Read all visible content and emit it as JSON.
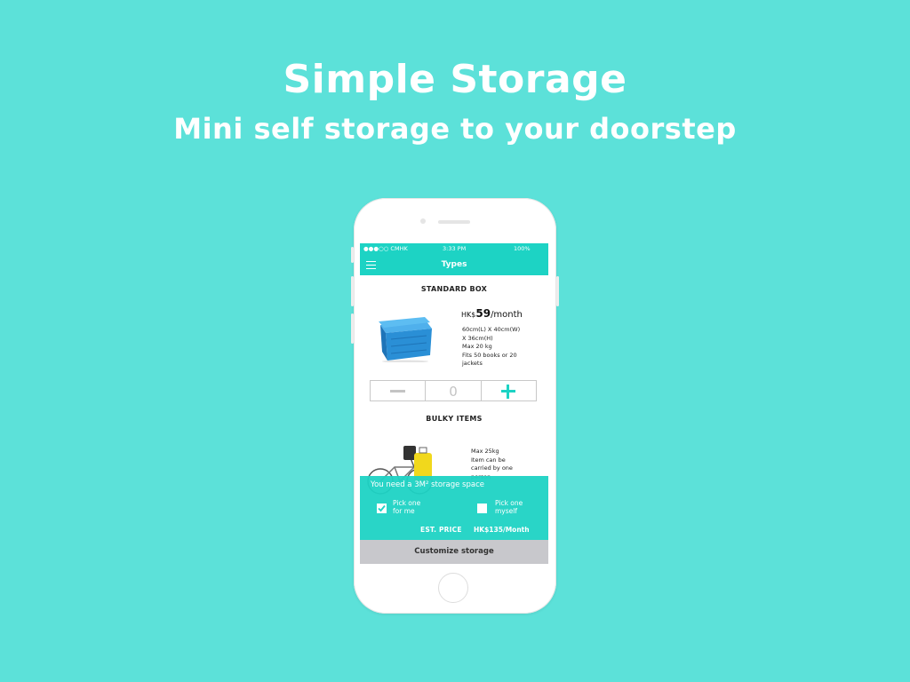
{
  "hero": {
    "title": "Simple Storage",
    "subtitle": "Mini self storage to your doorstep"
  },
  "status_bar": {
    "carrier": "●●●○○ CMHK",
    "time": "3:33 PM",
    "battery": "100%"
  },
  "nav": {
    "title": "Types",
    "menu_icon": "hamburger-menu-icon"
  },
  "standard_box": {
    "title": "STANDARD BOX",
    "currency": "HK$",
    "amount": "59",
    "period": "/month",
    "specs": [
      "60cm(L) X 40cm(W)",
      "X 36cm(H)",
      "Max 20 kg",
      "Fits 50 books or 20",
      "jackets"
    ],
    "quantity": "0"
  },
  "bulky_items": {
    "title": "BULKY ITEMS",
    "desc": [
      "Max 25kg",
      "Item can be",
      "carried by one",
      "person"
    ]
  },
  "storage_panel": {
    "headline": "You need a 3M² storage space",
    "option_pick_for_me": {
      "line1": "Pick one",
      "line2": "for me",
      "checked": true
    },
    "option_pick_myself": {
      "line1": "Pick one",
      "line2": "myself",
      "checked": false
    },
    "est_price_label": "EST. PRICE",
    "est_price_value": "HK$135/Month"
  },
  "cta": {
    "label": "Customize storage"
  },
  "colors": {
    "background": "#5ce1d9",
    "accent": "#1dd3c4",
    "cta_bg": "#c8c8cc",
    "box_blue": "#2a8fd6"
  }
}
